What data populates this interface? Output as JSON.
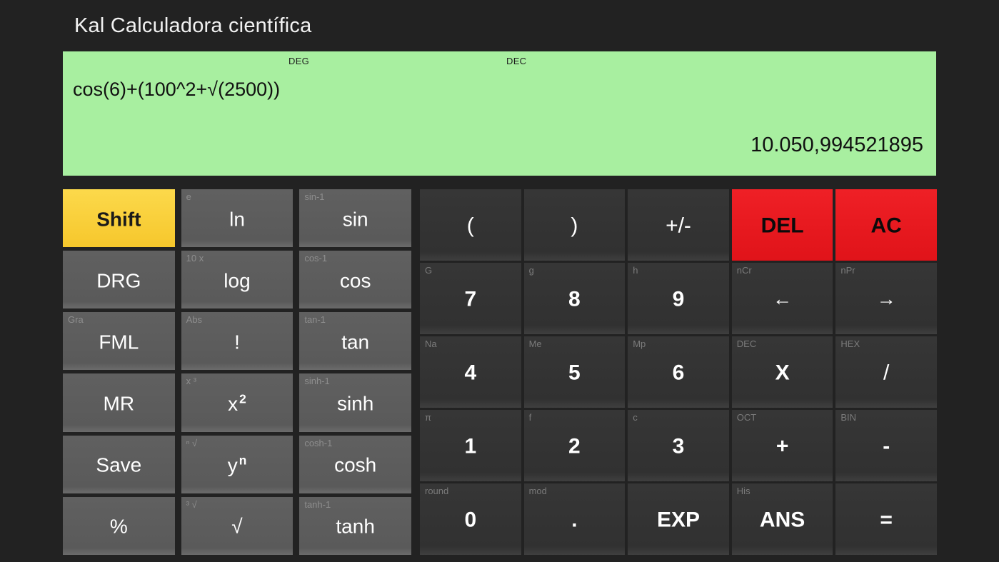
{
  "window": {
    "title": "Kal Calculadora científica",
    "background_color": "#222222"
  },
  "display": {
    "background_color": "#a8efa0",
    "angle_mode": "DEG",
    "base_mode": "DEC",
    "expression": "cos(6)+(100^2+√(2500))",
    "result": "10.050,994521895"
  },
  "colors": {
    "shift_accent": "#f6c72c",
    "danger_accent": "#ed1c24",
    "function_key": "#5c5c5c",
    "number_key": "#333333"
  },
  "function_keys": [
    {
      "id": "shift",
      "label": "Shift",
      "sup": "",
      "style": "shift"
    },
    {
      "id": "ln",
      "label": "ln",
      "sup": "e",
      "style": "func"
    },
    {
      "id": "sin",
      "label": "sin",
      "sup": "sin-1",
      "style": "func"
    },
    {
      "id": "drg",
      "label": "DRG",
      "sup": "",
      "style": "func"
    },
    {
      "id": "log",
      "label": "log",
      "sup": "10 x",
      "style": "func"
    },
    {
      "id": "cos",
      "label": "cos",
      "sup": "cos-1",
      "style": "func"
    },
    {
      "id": "fml",
      "label": "FML",
      "sup": "Gra",
      "style": "func"
    },
    {
      "id": "fact",
      "label": "!",
      "sup": "Abs",
      "style": "func"
    },
    {
      "id": "tan",
      "label": "tan",
      "sup": "tan-1",
      "style": "func"
    },
    {
      "id": "mr",
      "label": "MR",
      "sup": "",
      "style": "func"
    },
    {
      "id": "xsq",
      "label": "x",
      "sup": "x ³",
      "style": "func",
      "exponent": "2"
    },
    {
      "id": "sinh",
      "label": "sinh",
      "sup": "sinh-1",
      "style": "func"
    },
    {
      "id": "save",
      "label": "Save",
      "sup": "",
      "style": "func"
    },
    {
      "id": "ypown",
      "label": "y",
      "sup": "ⁿ √",
      "style": "func",
      "exponent": "n"
    },
    {
      "id": "cosh",
      "label": "cosh",
      "sup": "cosh-1",
      "style": "func"
    },
    {
      "id": "percent",
      "label": "%",
      "sup": "",
      "style": "func"
    },
    {
      "id": "sqrt",
      "label": "√",
      "sup": "³ √",
      "style": "func"
    },
    {
      "id": "tanh",
      "label": "tanh",
      "sup": "tanh-1",
      "style": "func"
    }
  ],
  "number_keys": [
    {
      "id": "paren-open",
      "label": "(",
      "sup": "",
      "style": "num thin"
    },
    {
      "id": "paren-close",
      "label": ")",
      "sup": "",
      "style": "num thin"
    },
    {
      "id": "sign",
      "label": "+/-",
      "sup": "",
      "style": "num thin"
    },
    {
      "id": "del",
      "label": "DEL",
      "sup": "",
      "style": "danger"
    },
    {
      "id": "ac",
      "label": "AC",
      "sup": "",
      "style": "danger"
    },
    {
      "id": "7",
      "label": "7",
      "sup": "G",
      "style": "num"
    },
    {
      "id": "8",
      "label": "8",
      "sup": "g",
      "style": "num"
    },
    {
      "id": "9",
      "label": "9",
      "sup": "h",
      "style": "num"
    },
    {
      "id": "cursor-left",
      "label": "←",
      "sup": "nCr",
      "style": "num arrow"
    },
    {
      "id": "cursor-right",
      "label": "→",
      "sup": "nPr",
      "style": "num arrow"
    },
    {
      "id": "4",
      "label": "4",
      "sup": "Na",
      "style": "num"
    },
    {
      "id": "5",
      "label": "5",
      "sup": "Me",
      "style": "num"
    },
    {
      "id": "6",
      "label": "6",
      "sup": "Mp",
      "style": "num"
    },
    {
      "id": "multiply",
      "label": "X",
      "sup": "DEC",
      "style": "num"
    },
    {
      "id": "divide",
      "label": "/",
      "sup": "HEX",
      "style": "num thin"
    },
    {
      "id": "1",
      "label": "1",
      "sup": "π",
      "style": "num"
    },
    {
      "id": "2",
      "label": "2",
      "sup": "f",
      "style": "num"
    },
    {
      "id": "3",
      "label": "3",
      "sup": "c",
      "style": "num"
    },
    {
      "id": "plus",
      "label": "+",
      "sup": "OCT",
      "style": "num"
    },
    {
      "id": "minus",
      "label": "-",
      "sup": "BIN",
      "style": "num"
    },
    {
      "id": "0",
      "label": "0",
      "sup": "round",
      "style": "num"
    },
    {
      "id": "decimal",
      "label": ".",
      "sup": "mod",
      "style": "num"
    },
    {
      "id": "exp",
      "label": "EXP",
      "sup": "",
      "style": "num"
    },
    {
      "id": "ans",
      "label": "ANS",
      "sup": "His",
      "style": "num"
    },
    {
      "id": "equals",
      "label": "=",
      "sup": "",
      "style": "num"
    }
  ]
}
